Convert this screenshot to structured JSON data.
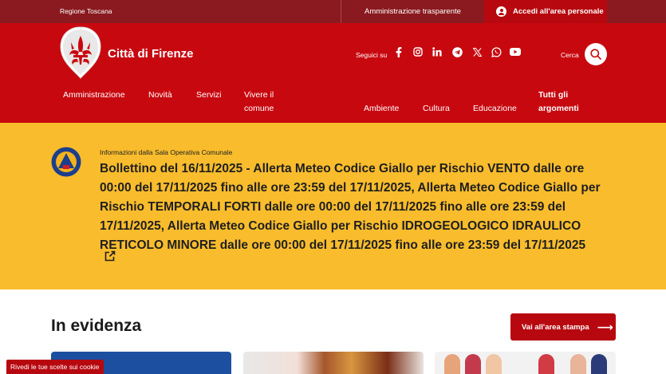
{
  "topbar": {
    "region": "Regione Toscana",
    "transparency": "Amministrazione trasparente",
    "login": "Accedi all'area personale"
  },
  "header": {
    "city": "Città di Firenze",
    "social_label": "Seguici su",
    "social_icons": [
      "facebook-icon",
      "instagram-icon",
      "linkedin-icon",
      "telegram-icon",
      "x-icon",
      "whatsapp-icon",
      "youtube-icon"
    ],
    "search_label": "Cerca"
  },
  "nav": {
    "primary": [
      {
        "label": "Amministrazione"
      },
      {
        "label": "Novità"
      },
      {
        "label": "Servizi"
      },
      {
        "label_line1": "Vivere il",
        "label_line2": "comune"
      }
    ],
    "secondary": [
      {
        "label": "Ambiente"
      },
      {
        "label": "Cultura"
      },
      {
        "label": "Educazione"
      },
      {
        "label_line1": "Tutti gli",
        "label_line2": "argomenti"
      }
    ]
  },
  "alert": {
    "source": "Informazioni dalla Sala Operativa Comunale",
    "message": "Bollettino del 16/11/2025 - Allerta Meteo Codice Giallo per Rischio VENTO dalle ore 00:00 del 17/11/2025 fino alle ore 23:59 del 17/11/2025, Allerta Meteo Codice Giallo per Rischio TEMPORALI FORTI dalle ore 00:00 del 17/11/2025 fino alle ore 23:59 del 17/11/2025, Allerta Meteo Codice Giallo per Rischio IDROGEOLOGICO IDRAULICO RETICOLO MINORE dalle ore 00:00 del 17/11/2025 fino alle ore 23:59 del 17/11/2025"
  },
  "evidenza": {
    "title": "In evidenza",
    "press_button": "Vai all'area stampa"
  },
  "cookie": {
    "label": "Rivedi le tue scelte sui cookie"
  },
  "colors": {
    "topbar": "#8a1a1f",
    "header": "#c8080f",
    "accent": "#b7080f",
    "alert_bg": "#f9bc2c"
  }
}
